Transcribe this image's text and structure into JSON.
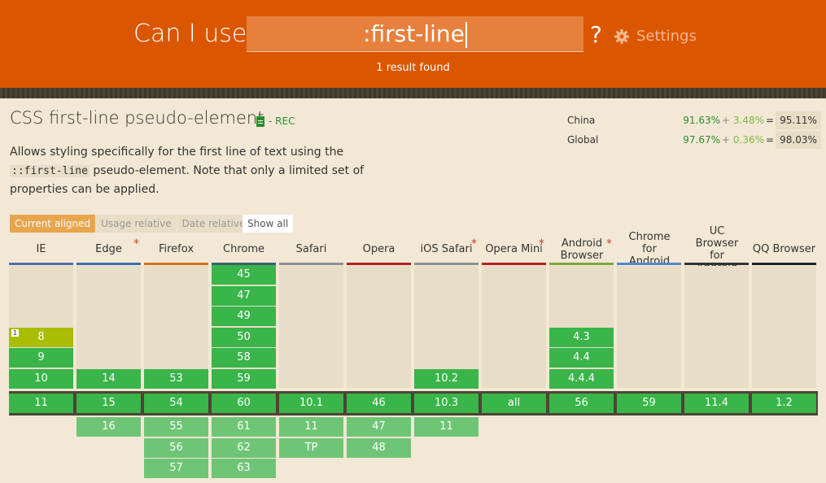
{
  "header": {
    "brand": "Can I use",
    "search_value": ":first-line",
    "question": "?",
    "settings_label": "Settings",
    "result_text": "1 result found",
    "color": "#db5600"
  },
  "feature": {
    "title": "CSS first-line pseudo-element",
    "spec": "- REC",
    "desc_before": "Allows styling specifically for the first line of text using the ",
    "desc_code": "::first-line",
    "desc_after": " pseudo-element. Note that only a limited set of properties can be applied."
  },
  "usage": [
    {
      "label": "China",
      "supported": "91.63%",
      "plus": "+",
      "partial": "3.48%",
      "eq": "=",
      "total": "95.11%"
    },
    {
      "label": "Global",
      "supported": "97.67%",
      "plus": "+",
      "partial": "0.36%",
      "eq": "=",
      "total": "98.03%"
    }
  ],
  "tabs": {
    "current": "Current aligned",
    "usage": "Usage relative",
    "date": "Date relative",
    "show_all": "Show all"
  },
  "browsers": [
    {
      "name": "IE",
      "color": "#4f6fab",
      "asterisk": false,
      "past": [
        {
          "v": "8",
          "s": "pa",
          "note": "1"
        },
        {
          "v": "9",
          "s": "y"
        },
        {
          "v": "10",
          "s": "y"
        }
      ],
      "current": "11",
      "future": []
    },
    {
      "name": "Edge",
      "color": "#3d6fb0",
      "asterisk": true,
      "past": [
        {
          "v": "14",
          "s": "y"
        }
      ],
      "current": "15",
      "future": [
        "16"
      ]
    },
    {
      "name": "Firefox",
      "color": "#d2731a",
      "asterisk": false,
      "past": [
        {
          "v": "53",
          "s": "y"
        }
      ],
      "current": "54",
      "future": [
        "55",
        "56",
        "57"
      ]
    },
    {
      "name": "Chrome",
      "color": "#3a6070",
      "asterisk": false,
      "past": [
        {
          "v": "45",
          "s": "y"
        },
        {
          "v": "47",
          "s": "y"
        },
        {
          "v": "49",
          "s": "y"
        },
        {
          "v": "50",
          "s": "y"
        },
        {
          "v": "58",
          "s": "y"
        },
        {
          "v": "59",
          "s": "y"
        }
      ],
      "current": "60",
      "future": [
        "61",
        "62",
        "63"
      ]
    },
    {
      "name": "Safari",
      "color": "#8f8f8f",
      "asterisk": false,
      "past": [],
      "current": "10.1",
      "future": [
        "11",
        "TP"
      ]
    },
    {
      "name": "Opera",
      "color": "#b22222",
      "asterisk": false,
      "past": [],
      "current": "46",
      "future": [
        "47",
        "48"
      ]
    },
    {
      "name": "iOS Safari",
      "color": "#8f8f8f",
      "asterisk": true,
      "past": [
        {
          "v": "10.2",
          "s": "y"
        }
      ],
      "current": "10.3",
      "future": [
        "11"
      ]
    },
    {
      "name": "Opera Mini",
      "color": "#b22222",
      "asterisk": true,
      "past": [],
      "current": "all",
      "future": []
    },
    {
      "name": "Android Browser",
      "color": "#7ea63c",
      "asterisk": true,
      "past": [
        {
          "v": "4.3",
          "s": "y"
        },
        {
          "v": "4.4",
          "s": "y"
        },
        {
          "v": "4.4.4",
          "s": "y"
        }
      ],
      "current": "56",
      "future": []
    },
    {
      "name": "Chrome for Android",
      "color": "#4f8ac9",
      "asterisk": false,
      "past": [],
      "current": "59",
      "future": []
    },
    {
      "name": "UC Browser for Android",
      "color": "#333333",
      "asterisk": false,
      "past": [],
      "current": "11.4",
      "future": []
    },
    {
      "name": "QQ Browser",
      "color": "#222222",
      "asterisk": false,
      "past": [],
      "current": "1.2",
      "future": []
    }
  ]
}
